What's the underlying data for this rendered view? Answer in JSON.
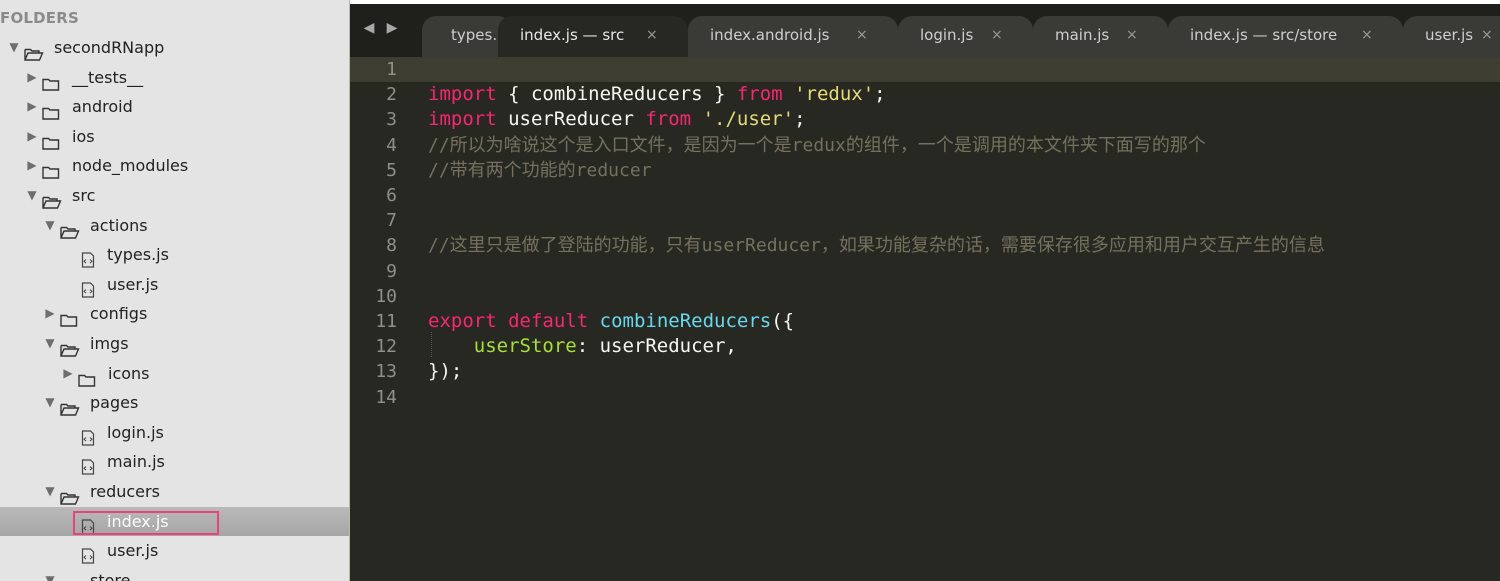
{
  "sidebar": {
    "header": "FOLDERS",
    "tree": [
      {
        "label": "secondRNapp",
        "type": "folder",
        "expanded": true,
        "depth": 0
      },
      {
        "label": "__tests__",
        "type": "folder",
        "expanded": false,
        "depth": 1
      },
      {
        "label": "android",
        "type": "folder",
        "expanded": false,
        "depth": 1
      },
      {
        "label": "ios",
        "type": "folder",
        "expanded": false,
        "depth": 1
      },
      {
        "label": "node_modules",
        "type": "folder",
        "expanded": false,
        "depth": 1
      },
      {
        "label": "src",
        "type": "folder",
        "expanded": true,
        "depth": 1
      },
      {
        "label": "actions",
        "type": "folder",
        "expanded": true,
        "depth": 2
      },
      {
        "label": "types.js",
        "type": "file",
        "depth": 3
      },
      {
        "label": "user.js",
        "type": "file",
        "depth": 3
      },
      {
        "label": "configs",
        "type": "folder",
        "expanded": false,
        "depth": 2
      },
      {
        "label": "imgs",
        "type": "folder",
        "expanded": true,
        "depth": 2
      },
      {
        "label": "icons",
        "type": "folder",
        "expanded": false,
        "depth": 3
      },
      {
        "label": "pages",
        "type": "folder",
        "expanded": true,
        "depth": 2
      },
      {
        "label": "login.js",
        "type": "file",
        "depth": 3
      },
      {
        "label": "main.js",
        "type": "file",
        "depth": 3
      },
      {
        "label": "reducers",
        "type": "folder",
        "expanded": true,
        "depth": 2
      },
      {
        "label": "index.js",
        "type": "file",
        "depth": 3,
        "selected": true
      },
      {
        "label": "user.js",
        "type": "file",
        "depth": 3
      },
      {
        "label": "store",
        "type": "folder",
        "expanded": true,
        "depth": 2
      }
    ]
  },
  "tabs": {
    "back_icon": "left-arrow-icon",
    "forward_icon": "right-arrow-icon",
    "items": [
      {
        "label": "types.",
        "active": false,
        "closable": false
      },
      {
        "label": "index.js — src",
        "active": true,
        "closable": true
      },
      {
        "label": "index.android.js",
        "active": false,
        "closable": true
      },
      {
        "label": "login.js",
        "active": false,
        "closable": true
      },
      {
        "label": "main.js",
        "active": false,
        "closable": true
      },
      {
        "label": "index.js — src/store",
        "active": false,
        "closable": true
      },
      {
        "label": "user.js",
        "active": false,
        "closable": true
      }
    ],
    "close_glyph": "×"
  },
  "editor": {
    "current_line": 1,
    "lines": [
      [],
      [
        {
          "t": "import",
          "c": "kw"
        },
        {
          "t": " { combineReducers } ",
          "c": ""
        },
        {
          "t": "from",
          "c": "kw"
        },
        {
          "t": " ",
          "c": ""
        },
        {
          "t": "'redux'",
          "c": "str"
        },
        {
          "t": ";",
          "c": ""
        }
      ],
      [
        {
          "t": "import",
          "c": "kw"
        },
        {
          "t": " userReducer ",
          "c": ""
        },
        {
          "t": "from",
          "c": "kw"
        },
        {
          "t": " ",
          "c": ""
        },
        {
          "t": "'./user'",
          "c": "str"
        },
        {
          "t": ";",
          "c": ""
        }
      ],
      [
        {
          "t": "//所以为啥说这个是入口文件，是因为一个是redux的组件，一个是调用的本文件夹下面写的那个",
          "c": "cm"
        }
      ],
      [
        {
          "t": "//带有两个功能的reducer",
          "c": "cm"
        }
      ],
      [],
      [],
      [
        {
          "t": "//这里只是做了登陆的功能，只有userReducer，如果功能复杂的话，需要保存很多应用和用户交互产生的信息",
          "c": "cm"
        }
      ],
      [],
      [],
      [
        {
          "t": "export",
          "c": "kw"
        },
        {
          "t": " ",
          "c": ""
        },
        {
          "t": "default",
          "c": "kw"
        },
        {
          "t": " ",
          "c": ""
        },
        {
          "t": "combineReducers",
          "c": "fn"
        },
        {
          "t": "({",
          "c": ""
        }
      ],
      [
        {
          "t": "    ",
          "c": ""
        },
        {
          "t": "userStore",
          "c": "prop"
        },
        {
          "t": ": userReducer,",
          "c": ""
        }
      ],
      [
        {
          "t": "});",
          "c": ""
        }
      ],
      []
    ]
  },
  "colors": {
    "accent_highlight": "#e9437d",
    "keyword": "#f92672",
    "string": "#e6db74",
    "function": "#66d9ef",
    "property": "#a6e22e",
    "comment": "#75715e"
  }
}
